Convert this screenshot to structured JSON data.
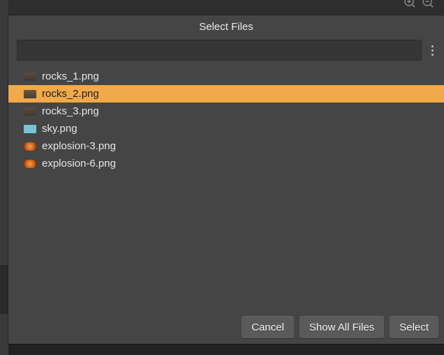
{
  "dialog": {
    "title": "Select Files",
    "search_value": "",
    "search_placeholder": ""
  },
  "files": [
    {
      "name": "rocks_1.png",
      "thumb": "rock",
      "selected": false
    },
    {
      "name": "rocks_2.png",
      "thumb": "rock2",
      "selected": true
    },
    {
      "name": "rocks_3.png",
      "thumb": "rock",
      "selected": false
    },
    {
      "name": "sky.png",
      "thumb": "sky",
      "selected": false
    },
    {
      "name": "explosion-3.png",
      "thumb": "exp",
      "selected": false
    },
    {
      "name": "explosion-6.png",
      "thumb": "exp",
      "selected": false
    }
  ],
  "buttons": {
    "cancel": "Cancel",
    "show_all": "Show All Files",
    "select": "Select"
  }
}
